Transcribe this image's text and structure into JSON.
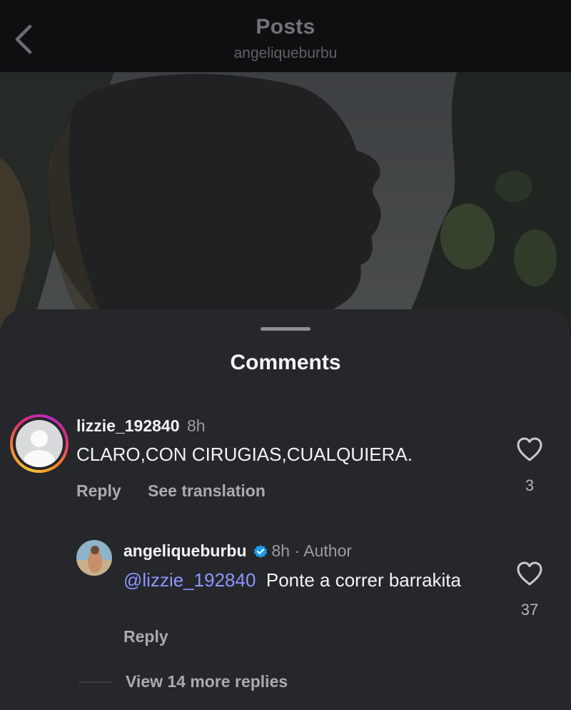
{
  "header": {
    "title": "Posts",
    "subtitle": "angeliqueburbu",
    "back_icon": "chevron-left-icon"
  },
  "post": {
    "image_icon": "post-photo"
  },
  "comments_sheet": {
    "title": "Comments",
    "comments": [
      {
        "username": "lizzie_192840",
        "time": "8h",
        "text": "CLARO,CON CIRUGIAS,CUALQUIERA.",
        "reply_label": "Reply",
        "translate_label": "See translation",
        "like_count": "3",
        "like_icon": "heart-outline-icon",
        "avatar_icon": "default-avatar-icon",
        "story_ring_colors": [
          "#f9c33a",
          "#f58529",
          "#dd2a7b",
          "#b32bc2"
        ]
      }
    ],
    "reply": {
      "username": "angeliqueburbu",
      "verified_icon": "verified-badge-icon",
      "time": "8h · Author",
      "mention": "@lizzie_192840",
      "text": "Ponte a correr barrakita",
      "reply_label": "Reply",
      "like_count": "37",
      "like_icon": "heart-outline-icon"
    },
    "view_more": "View 14 more replies"
  },
  "colors": {
    "sheet_background": "#25272b",
    "mention": "#8e97ff",
    "verified": "#1d9bf0"
  }
}
